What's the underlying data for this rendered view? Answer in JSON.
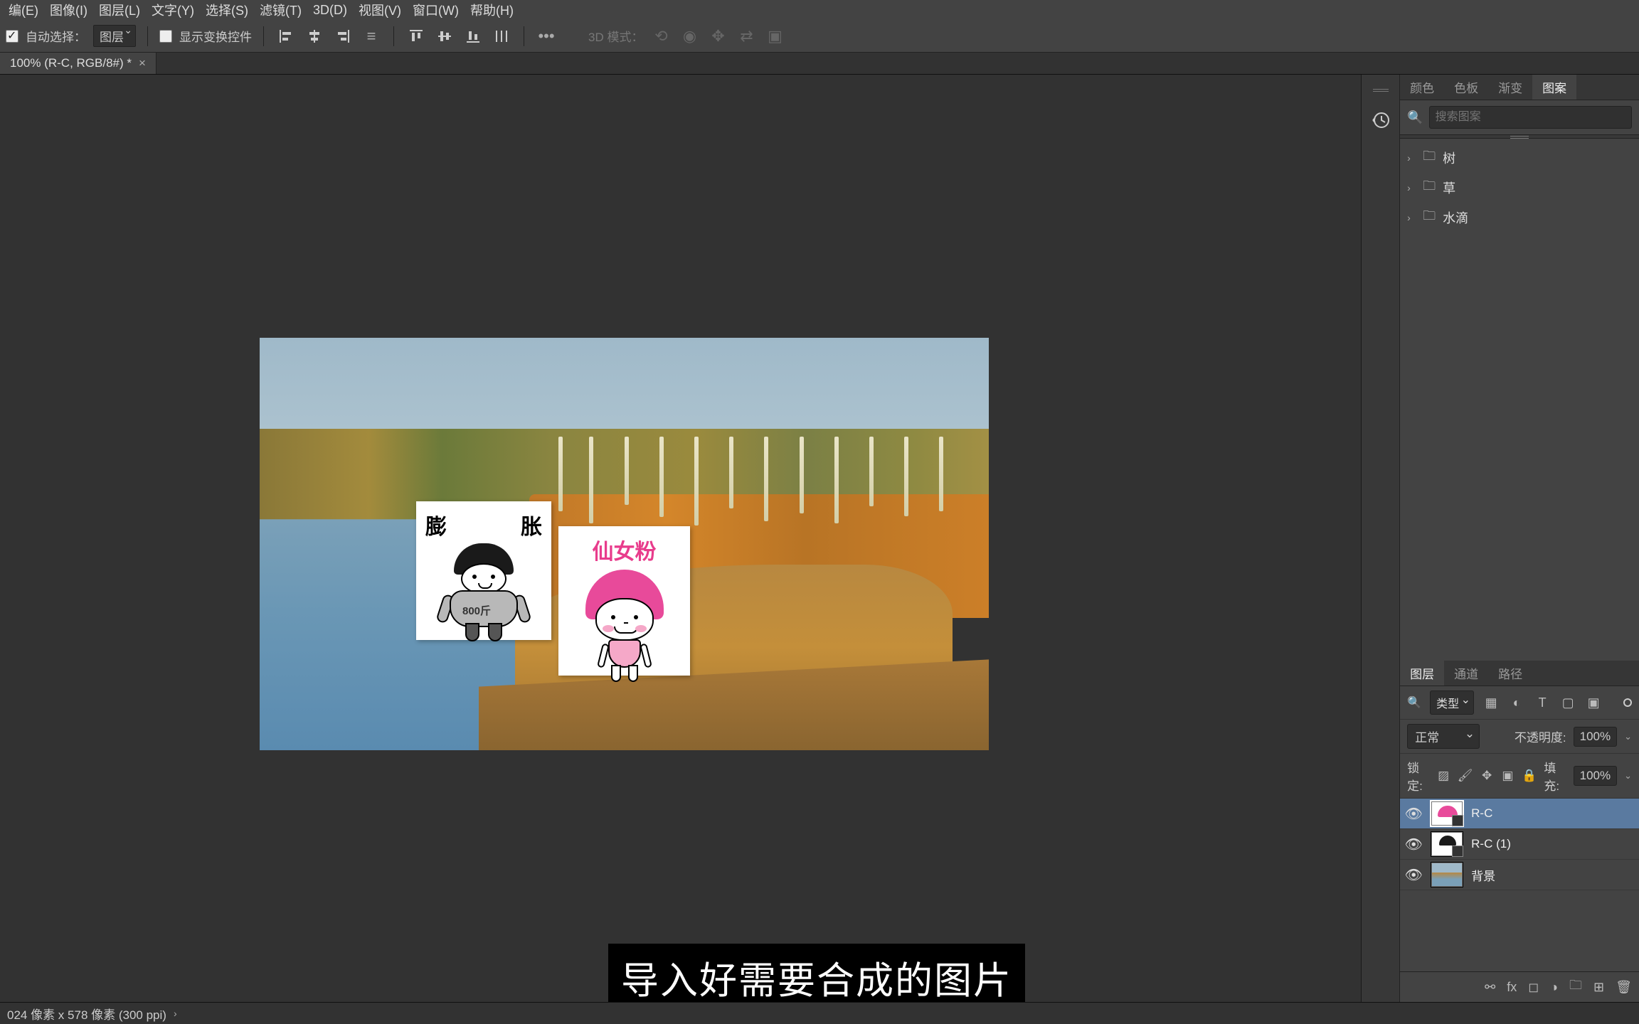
{
  "menubar": [
    "编(E)",
    "图像(I)",
    "图层(L)",
    "文字(Y)",
    "选择(S)",
    "滤镜(T)",
    "3D(D)",
    "视图(V)",
    "窗口(W)",
    "帮助(H)"
  ],
  "options": {
    "auto_select_label": "自动选择：",
    "auto_select_value": "图层",
    "show_transform_label": "显示变换控件",
    "mode_3d_label": "3D 模式："
  },
  "tab": {
    "title": "100% (R-C, RGB/8#) *"
  },
  "subtitle_text": "导入好需要合成的图片",
  "status": {
    "text": "024 像素 x 578 像素 (300 ppi)"
  },
  "canvas": {
    "sticker1": {
      "left": "膨",
      "right": "胀",
      "weight": "800斤"
    },
    "sticker2": {
      "title": "仙女粉"
    }
  },
  "patterns": {
    "tabs": [
      "颜色",
      "色板",
      "渐变",
      "图案"
    ],
    "active_tab": 3,
    "search_placeholder": "搜索图案",
    "folders": [
      "树",
      "草",
      "水滴"
    ]
  },
  "layers_panel": {
    "tabs": [
      "图层",
      "通道",
      "路径"
    ],
    "active_tab": 0,
    "filter_label": "类型",
    "blend_mode": "正常",
    "opacity_label": "不透明度:",
    "opacity_value": "100%",
    "lock_label": "锁定:",
    "fill_label": "填充:",
    "fill_value": "100%",
    "layers": [
      {
        "name": "R-C",
        "selected": true,
        "smart": true,
        "thumb": "s2"
      },
      {
        "name": "R-C (1)",
        "selected": false,
        "smart": true,
        "thumb": "s1"
      },
      {
        "name": "背景",
        "selected": false,
        "smart": false,
        "thumb": "bg"
      }
    ]
  }
}
